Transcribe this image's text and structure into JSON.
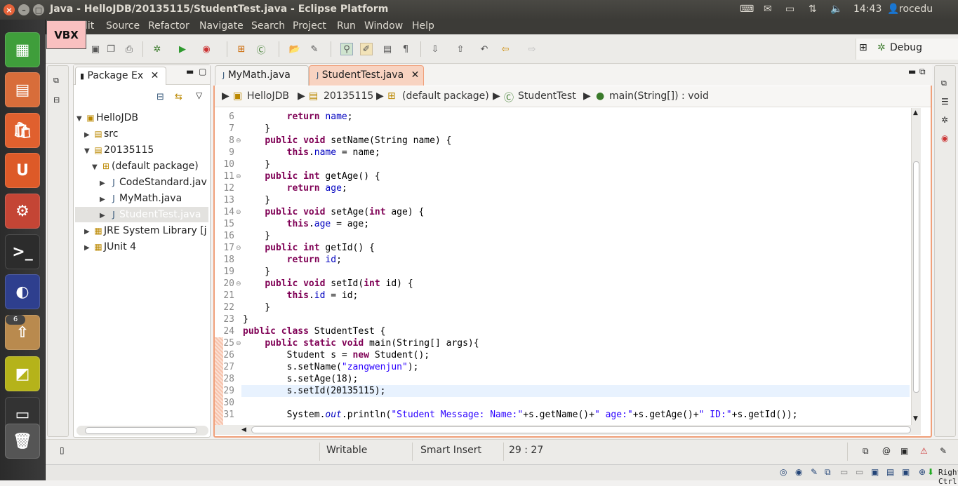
{
  "window": {
    "title": "Java - HelloJDB/20135115/StudentTest.java - Eclipse Platform",
    "clock": "14:43",
    "user": "rocedu"
  },
  "overlay": {
    "label": "VBX"
  },
  "menu": [
    "lit",
    "Source",
    "Refactor",
    "Navigate",
    "Search",
    "Project",
    "Run",
    "Window",
    "Help"
  ],
  "perspective": {
    "label": "Debug"
  },
  "launcher": {
    "badge": "6"
  },
  "package_explorer": {
    "tab_label": "Package Ex",
    "tree": [
      {
        "label": "HelloJDB",
        "twisty": "▼",
        "icon": "project-icon",
        "glyph": "▣",
        "level": 0
      },
      {
        "label": "src",
        "twisty": "▶",
        "icon": "folder-icon",
        "glyph": "▤",
        "level": 1
      },
      {
        "label": "20135115",
        "twisty": "▼",
        "icon": "folder-icon",
        "glyph": "▤",
        "level": 1
      },
      {
        "label": "(default package)",
        "twisty": "▼",
        "icon": "package-icon",
        "glyph": "⊞",
        "level": 2
      },
      {
        "label": "CodeStandard.java",
        "twisty": "▶",
        "icon": "java-file-icon",
        "glyph": "J",
        "level": 3
      },
      {
        "label": "MyMath.java",
        "twisty": "▶",
        "icon": "java-file-icon",
        "glyph": "J",
        "level": 3
      },
      {
        "label": "StudentTest.java",
        "twisty": "▶",
        "icon": "java-file-icon",
        "glyph": "J",
        "level": 3,
        "selected": true
      },
      {
        "label": "JRE System Library [ja",
        "twisty": "▶",
        "icon": "library-icon",
        "glyph": "▦",
        "level": 1
      },
      {
        "label": "JUnit 4",
        "twisty": "▶",
        "icon": "library-icon",
        "glyph": "▦",
        "level": 1
      }
    ]
  },
  "editor": {
    "tabs": [
      {
        "label": "MyMath.java",
        "active": false
      },
      {
        "label": "StudentTest.java",
        "active": true
      }
    ],
    "breadcrumb": [
      "HelloJDB",
      "20135115",
      "(default package)",
      "StudentTest",
      "main(String[]) : void"
    ],
    "lines": [
      {
        "n": "6",
        "fold": false,
        "tokens": [
          [
            "",
            "        "
          ],
          [
            "kw",
            "return"
          ],
          [
            "",
            " "
          ],
          [
            "fd",
            "name"
          ],
          [
            "",
            ";"
          ]
        ]
      },
      {
        "n": "7",
        "fold": false,
        "tokens": [
          [
            "",
            "    }"
          ]
        ]
      },
      {
        "n": "8",
        "fold": true,
        "tokens": [
          [
            "",
            "    "
          ],
          [
            "kw",
            "public"
          ],
          [
            "",
            " "
          ],
          [
            "kw",
            "void"
          ],
          [
            "",
            " setName(String name) {"
          ]
        ]
      },
      {
        "n": "9",
        "fold": false,
        "tokens": [
          [
            "",
            "        "
          ],
          [
            "kw",
            "this"
          ],
          [
            "",
            "."
          ],
          [
            "fd",
            "name"
          ],
          [
            "",
            " = name;"
          ]
        ]
      },
      {
        "n": "10",
        "fold": false,
        "tokens": [
          [
            "",
            "    }"
          ]
        ]
      },
      {
        "n": "11",
        "fold": true,
        "tokens": [
          [
            "",
            "    "
          ],
          [
            "kw",
            "public"
          ],
          [
            "",
            " "
          ],
          [
            "kw",
            "int"
          ],
          [
            "",
            " getAge() {"
          ]
        ]
      },
      {
        "n": "12",
        "fold": false,
        "tokens": [
          [
            "",
            "        "
          ],
          [
            "kw",
            "return"
          ],
          [
            "",
            " "
          ],
          [
            "fd",
            "age"
          ],
          [
            "",
            ";"
          ]
        ]
      },
      {
        "n": "13",
        "fold": false,
        "tokens": [
          [
            "",
            "    }"
          ]
        ]
      },
      {
        "n": "14",
        "fold": true,
        "tokens": [
          [
            "",
            "    "
          ],
          [
            "kw",
            "public"
          ],
          [
            "",
            " "
          ],
          [
            "kw",
            "void"
          ],
          [
            "",
            " setAge("
          ],
          [
            "kw",
            "int"
          ],
          [
            "",
            " age) {"
          ]
        ]
      },
      {
        "n": "15",
        "fold": false,
        "tokens": [
          [
            "",
            "        "
          ],
          [
            "kw",
            "this"
          ],
          [
            "",
            "."
          ],
          [
            "fd",
            "age"
          ],
          [
            "",
            " = age;"
          ]
        ]
      },
      {
        "n": "16",
        "fold": false,
        "tokens": [
          [
            "",
            "    }"
          ]
        ]
      },
      {
        "n": "17",
        "fold": true,
        "tokens": [
          [
            "",
            "    "
          ],
          [
            "kw",
            "public"
          ],
          [
            "",
            " "
          ],
          [
            "kw",
            "int"
          ],
          [
            "",
            " getId() {"
          ]
        ]
      },
      {
        "n": "18",
        "fold": false,
        "tokens": [
          [
            "",
            "        "
          ],
          [
            "kw",
            "return"
          ],
          [
            "",
            " "
          ],
          [
            "fd",
            "id"
          ],
          [
            "",
            ";"
          ]
        ]
      },
      {
        "n": "19",
        "fold": false,
        "tokens": [
          [
            "",
            "    }"
          ]
        ]
      },
      {
        "n": "20",
        "fold": true,
        "tokens": [
          [
            "",
            "    "
          ],
          [
            "kw",
            "public"
          ],
          [
            "",
            " "
          ],
          [
            "kw",
            "void"
          ],
          [
            "",
            " setId("
          ],
          [
            "kw",
            "int"
          ],
          [
            "",
            " id) {"
          ]
        ]
      },
      {
        "n": "21",
        "fold": false,
        "tokens": [
          [
            "",
            "        "
          ],
          [
            "kw",
            "this"
          ],
          [
            "",
            "."
          ],
          [
            "fd",
            "id"
          ],
          [
            "",
            " = id;"
          ]
        ]
      },
      {
        "n": "22",
        "fold": false,
        "tokens": [
          [
            "",
            "    }"
          ]
        ]
      },
      {
        "n": "23",
        "fold": false,
        "tokens": [
          [
            "",
            "}"
          ]
        ]
      },
      {
        "n": "24",
        "fold": false,
        "tokens": [
          [
            "kw",
            "public"
          ],
          [
            "",
            " "
          ],
          [
            "kw",
            "class"
          ],
          [
            "",
            " StudentTest {"
          ]
        ]
      },
      {
        "n": "25",
        "fold": true,
        "tokens": [
          [
            "",
            "    "
          ],
          [
            "kw",
            "public"
          ],
          [
            "",
            " "
          ],
          [
            "kw",
            "static"
          ],
          [
            "",
            " "
          ],
          [
            "kw",
            "void"
          ],
          [
            "",
            " main(String[] args){"
          ]
        ]
      },
      {
        "n": "26",
        "fold": false,
        "tokens": [
          [
            "",
            "        Student s = "
          ],
          [
            "kw",
            "new"
          ],
          [
            "",
            " Student();"
          ]
        ]
      },
      {
        "n": "27",
        "fold": false,
        "tokens": [
          [
            "",
            "        s.setName("
          ],
          [
            "st",
            "\"zangwenjun\""
          ],
          [
            "",
            ");"
          ]
        ]
      },
      {
        "n": "28",
        "fold": false,
        "tokens": [
          [
            "",
            "        s.setAge(18);"
          ]
        ]
      },
      {
        "n": "29",
        "fold": false,
        "tokens": [
          [
            "",
            "        s.setId(20135115);"
          ]
        ],
        "current": true
      },
      {
        "n": "30",
        "fold": false,
        "tokens": [
          [
            "",
            ""
          ]
        ]
      },
      {
        "n": "31",
        "fold": false,
        "tokens": [
          [
            "",
            "        System."
          ],
          [
            "it",
            "out"
          ],
          [
            "",
            ".println("
          ],
          [
            "st",
            "\"Student Message: Name:\""
          ],
          [
            "",
            "+s.getName()+"
          ],
          [
            "st",
            "\" age:\""
          ],
          [
            "",
            "+s.getAge()+"
          ],
          [
            "st",
            "\" ID:\""
          ],
          [
            "",
            "+s.getId());"
          ]
        ]
      }
    ]
  },
  "status": {
    "mode": "Writable",
    "insert": "Smart Insert",
    "position": "29 : 27"
  },
  "vbox": {
    "host_key": "Right Ctrl"
  },
  "colors": {
    "ubuntu_panel": "#3c3b37",
    "active_tab_accent": "#f0a07a",
    "current_line": "#e8f2fe",
    "keyword": "#7f0055",
    "field": "#0000c0",
    "string": "#2a00ff"
  }
}
